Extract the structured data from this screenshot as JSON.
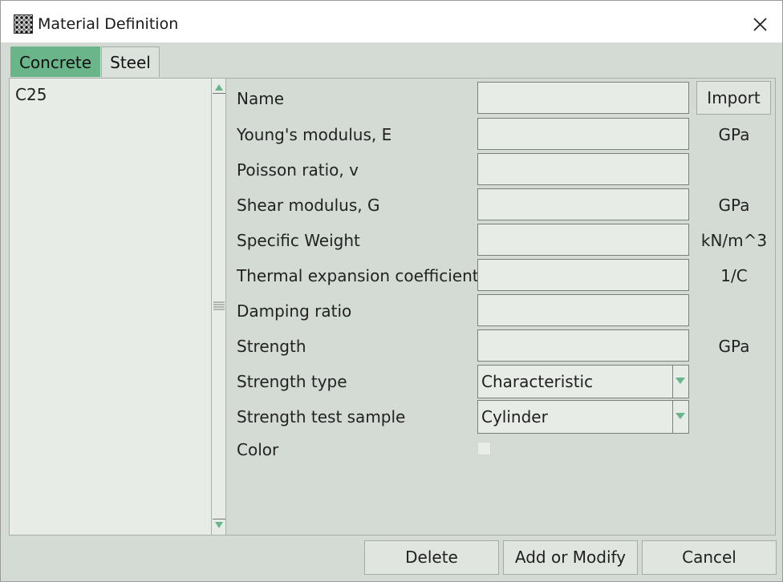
{
  "window": {
    "title": "Material Definition"
  },
  "icons": {
    "app": "material-texture-icon",
    "close": "close-icon",
    "scroll_up": "triangle-up-icon",
    "scroll_down": "triangle-down-icon",
    "scroll_grip": "grip-lines-icon",
    "dropdown": "triangle-down-icon"
  },
  "colors": {
    "accent": "#6bb58a",
    "panel": "#d4dbd4",
    "field": "#e7ece7"
  },
  "tabs": [
    {
      "label": "Concrete",
      "active": true
    },
    {
      "label": "Steel",
      "active": false
    }
  ],
  "materials": [
    {
      "name": "C25"
    }
  ],
  "form": {
    "name_label": "Name",
    "name_value": "",
    "import_label": "Import",
    "youngs_label": "Young's modulus, E",
    "youngs_value": "",
    "youngs_unit": "GPa",
    "poisson_label": "Poisson ratio, v",
    "poisson_value": "",
    "shear_label": "Shear modulus, G",
    "shear_value": "",
    "shear_unit": "GPa",
    "weight_label": "Specific Weight",
    "weight_value": "",
    "weight_unit": "kN/m^3",
    "thermal_label": "Thermal expansion coefficient",
    "thermal_value": "",
    "thermal_unit": "1/C",
    "damping_label": "Damping ratio",
    "damping_value": "",
    "strength_label": "Strength",
    "strength_value": "",
    "strength_unit": "GPa",
    "strength_type_label": "Strength type",
    "strength_type_value": "Characteristic",
    "test_sample_label": "Strength test sample",
    "test_sample_value": "Cylinder",
    "color_label": "Color"
  },
  "buttons": {
    "delete": "Delete",
    "add_modify": "Add or Modify",
    "cancel": "Cancel"
  }
}
